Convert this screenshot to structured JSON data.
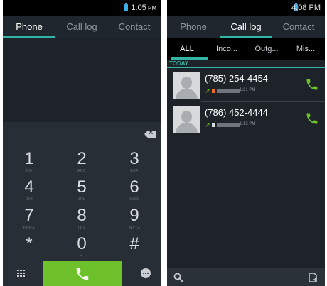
{
  "phone": {
    "status_time": "1:05",
    "status_ampm": "PM",
    "tabs": [
      {
        "label": "Phone",
        "active": true
      },
      {
        "label": "Call log",
        "active": false
      },
      {
        "label": "Contact",
        "active": false
      }
    ],
    "keypad": [
      {
        "digit": "1",
        "letters": "OO"
      },
      {
        "digit": "2",
        "letters": "ABC"
      },
      {
        "digit": "3",
        "letters": "DEF"
      },
      {
        "digit": "4",
        "letters": "GHI"
      },
      {
        "digit": "5",
        "letters": "JKL"
      },
      {
        "digit": "6",
        "letters": "MNO"
      },
      {
        "digit": "7",
        "letters": "PQRS"
      },
      {
        "digit": "8",
        "letters": "TUV"
      },
      {
        "digit": "9",
        "letters": "WXYZ"
      },
      {
        "digit": "*",
        "letters": ""
      },
      {
        "digit": "0",
        "letters": "+"
      },
      {
        "digit": "#",
        "letters": ""
      }
    ],
    "icons": {
      "backspace": "backspace-icon",
      "dialpad": "dialpad-icon",
      "call": "phone-icon",
      "message": "message-icon"
    },
    "colors": {
      "accent": "#33b5a5",
      "call_button": "#6ec12a"
    }
  },
  "calllog": {
    "status_time": "4:08",
    "status_ampm": "PM",
    "tabs": [
      {
        "label": "Phone",
        "active": false
      },
      {
        "label": "Call log",
        "active": true
      },
      {
        "label": "Contact",
        "active": false
      }
    ],
    "filters": [
      "ALL",
      "Inco...",
      "Outg...",
      "Mis..."
    ],
    "section": "TODAY",
    "entries": [
      {
        "number": "(785) 254-4454",
        "time": "1:21 PM",
        "type": "outgoing"
      },
      {
        "number": "(786) 452-4444",
        "time": "1:15 PM",
        "type": "outgoing"
      }
    ],
    "icons": {
      "search": "search-icon",
      "export": "export-icon",
      "call": "phone-icon"
    }
  }
}
